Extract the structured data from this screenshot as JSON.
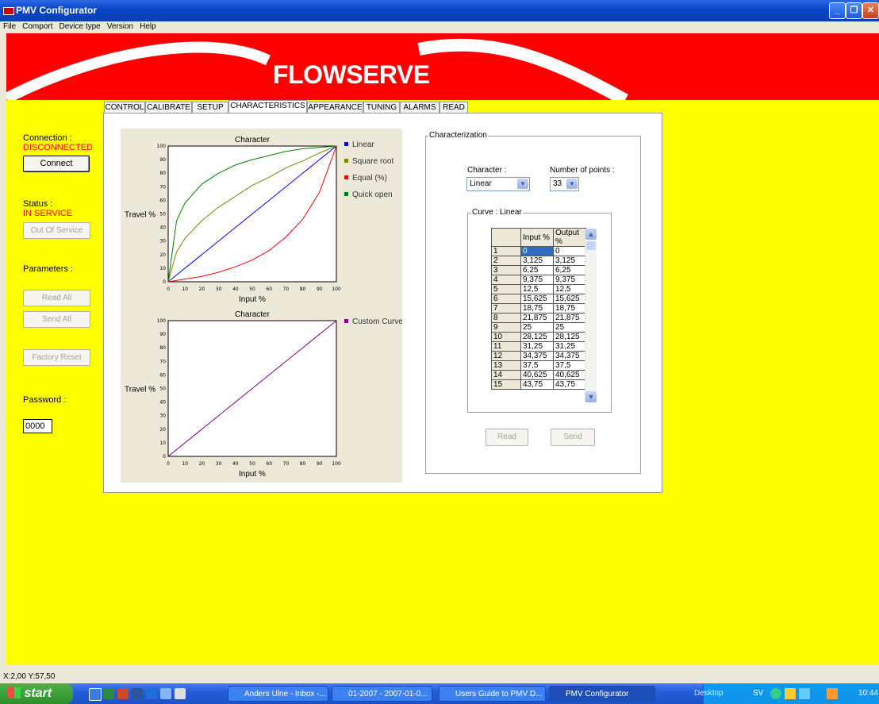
{
  "window": {
    "title": "PMV Configurator"
  },
  "menu": [
    "File",
    "Comport",
    "Device type",
    "Version",
    "Help"
  ],
  "brand": {
    "logo": "FLOWSERVE",
    "accent": "#ff0000",
    "background": "#ffff00"
  },
  "sidebar": {
    "connection_label": "Connection :",
    "connection_value": "DISCONNECTED",
    "connect_button": "Connect",
    "status_label": "Status :",
    "status_value": "IN SERVICE",
    "out_of_service_button": "Out Of Service",
    "parameters_label": "Parameters :",
    "read_all_button": "Read All",
    "send_all_button": "Send All",
    "factory_reset_button": "Factory Reset",
    "password_label": "Password :",
    "password_value": "0000"
  },
  "tabs": [
    "CONTROL",
    "CALIBRATE",
    "SETUP",
    "CHARACTERISTICS",
    "APPEARANCE",
    "TUNING",
    "ALARMS",
    "READ"
  ],
  "active_tab": "CHARACTERISTICS",
  "characterization": {
    "group_label": "Characterization",
    "character_label": "Character :",
    "character_value": "Linear",
    "points_label": "Number of points :",
    "points_value": "33",
    "curve_label": "Curve : Linear",
    "table_headers": [
      "Input %",
      "Output %"
    ],
    "rows": [
      [
        "1",
        "0",
        "0"
      ],
      [
        "2",
        "3,125",
        "3,125"
      ],
      [
        "3",
        "6,25",
        "6,25"
      ],
      [
        "4",
        "9,375",
        "9,375"
      ],
      [
        "5",
        "12,5",
        "12,5"
      ],
      [
        "6",
        "15,625",
        "15,625"
      ],
      [
        "7",
        "18,75",
        "18,75"
      ],
      [
        "8",
        "21,875",
        "21,875"
      ],
      [
        "9",
        "25",
        "25"
      ],
      [
        "10",
        "28,125",
        "28,125"
      ],
      [
        "11",
        "31,25",
        "31,25"
      ],
      [
        "12",
        "34,375",
        "34,375"
      ],
      [
        "13",
        "37,5",
        "37,5"
      ],
      [
        "14",
        "40,625",
        "40,625"
      ],
      [
        "15",
        "43,75",
        "43,75"
      ]
    ],
    "read_button": "Read",
    "send_button": "Send"
  },
  "chart_data": [
    {
      "type": "line",
      "title": "Character",
      "xlabel": "Input %",
      "ylabel": "Travel %",
      "xlim": [
        0,
        100
      ],
      "ylim": [
        0,
        100
      ],
      "ticks": [
        "0",
        "10",
        "20",
        "30",
        "40",
        "50",
        "60",
        "70",
        "80",
        "90",
        "100"
      ],
      "series": [
        {
          "name": "Linear",
          "color": "#0000ff",
          "x": [
            0,
            100
          ],
          "y": [
            0,
            100
          ]
        },
        {
          "name": "Square root",
          "color": "#808000",
          "x": [
            0,
            5,
            10,
            20,
            30,
            40,
            50,
            60,
            70,
            80,
            90,
            100
          ],
          "y": [
            0,
            22,
            32,
            45,
            55,
            63,
            71,
            77,
            84,
            89,
            95,
            100
          ]
        },
        {
          "name": "Equal (%)",
          "color": "#ff0000",
          "x": [
            0,
            10,
            20,
            30,
            40,
            50,
            60,
            70,
            80,
            90,
            100
          ],
          "y": [
            0,
            2,
            4,
            7,
            11,
            16,
            23,
            33,
            46,
            66,
            100
          ]
        },
        {
          "name": "Quick open",
          "color": "#008000",
          "x": [
            0,
            5,
            10,
            20,
            30,
            40,
            50,
            60,
            70,
            80,
            90,
            100
          ],
          "y": [
            0,
            45,
            58,
            72,
            80,
            86,
            90,
            93,
            96,
            98,
            99,
            100
          ]
        }
      ]
    },
    {
      "type": "line",
      "title": "Character",
      "xlabel": "Input %",
      "ylabel": "Travel %",
      "xlim": [
        0,
        100
      ],
      "ylim": [
        0,
        100
      ],
      "ticks": [
        "0",
        "10",
        "20",
        "30",
        "40",
        "50",
        "60",
        "70",
        "80",
        "90",
        "100"
      ],
      "series": [
        {
          "name": "Custom Curve",
          "color": "#800080",
          "x": [
            0,
            100
          ],
          "y": [
            0,
            100
          ]
        }
      ]
    }
  ],
  "statusbar": {
    "coords": "X:2,00 Y:57,50"
  },
  "taskbar": {
    "start": "start",
    "tasks": [
      "Anders Ulne - Inbox -...",
      "01-2007 - 2007-01-0...",
      "Users Guide to PMV D...",
      "PMV Configurator"
    ],
    "desktop_label": "Desktop",
    "lang": "SV",
    "clock": "10:44"
  }
}
